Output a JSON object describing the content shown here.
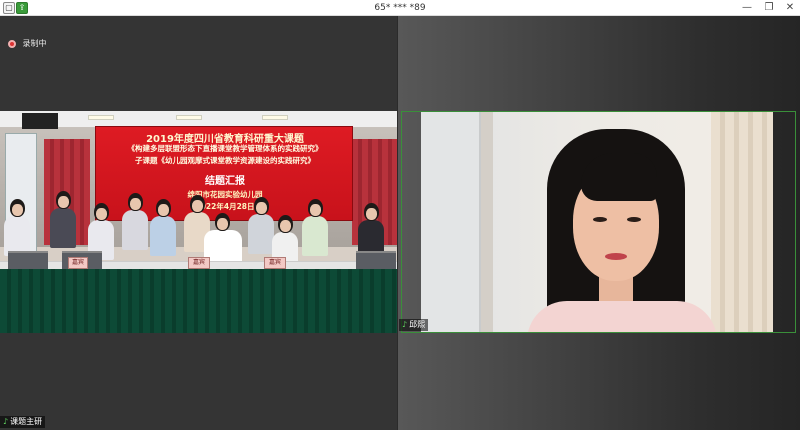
{
  "window": {
    "title": "65* *** *89",
    "minimize_glyph": "—",
    "maximize_glyph": "❐",
    "close_glyph": "✕",
    "app_icons": [
      "window-app-icon",
      "share-icon"
    ]
  },
  "recording": {
    "label": "录制中",
    "color": "#dd3333"
  },
  "participants": [
    {
      "name": "课题主研",
      "role": "main-video",
      "banner": {
        "line1": "2019年度四川省教育科研重大课题",
        "line2": "《构建多层联盟形态下直播课堂教学管理体系的实践研究》",
        "line3": "子课题《幼儿园观摩式课堂教学资源建设的实践研究》",
        "line4": "结题汇报",
        "line5": "绵阳市花园实验幼儿园",
        "line6": "2022年4月28日"
      },
      "nameplates": [
        "嘉宾",
        "嘉宾",
        "嘉宾"
      ]
    },
    {
      "name": "邱熙",
      "role": "active-speaker",
      "border_color": "#3a8f3a"
    }
  ]
}
